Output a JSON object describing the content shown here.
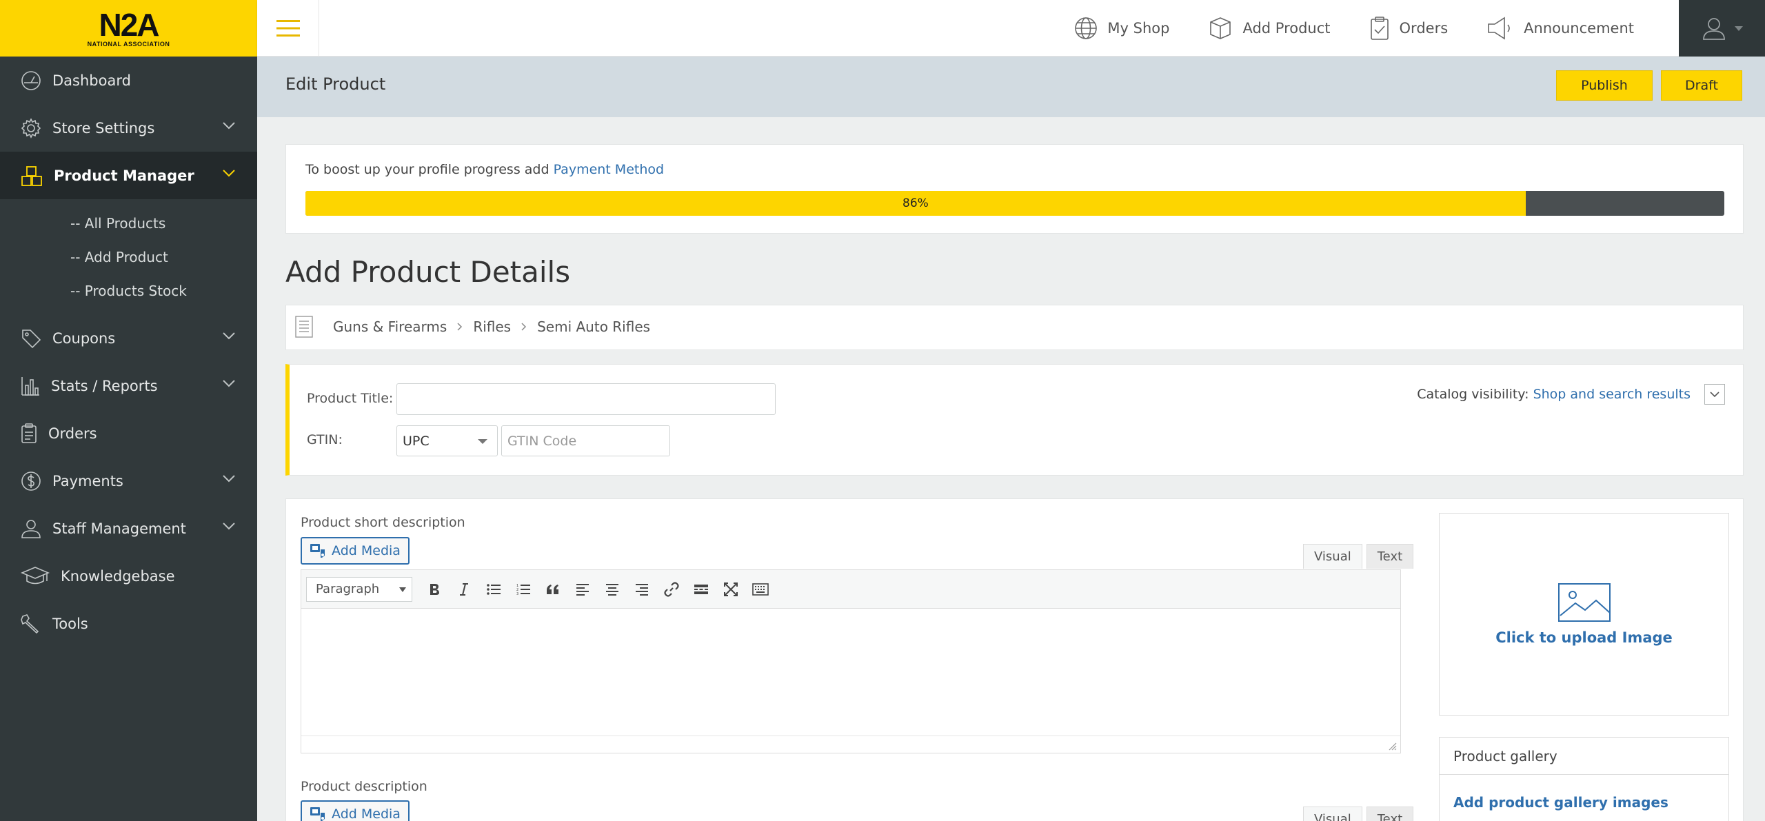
{
  "logo": {
    "main": "N2A",
    "sub": "NATIONAL ASSOCIATION"
  },
  "topnav": [
    {
      "icon": "globe-icon",
      "label": "My Shop"
    },
    {
      "icon": "box-icon",
      "label": "Add Product"
    },
    {
      "icon": "clipboard-icon",
      "label": "Orders"
    },
    {
      "icon": "megaphone-icon",
      "label": "Announcement"
    }
  ],
  "sidebar": {
    "items": [
      {
        "icon": "dashboard-icon",
        "label": "Dashboard"
      },
      {
        "icon": "gear-icon",
        "label": "Store Settings"
      },
      {
        "icon": "boxes-icon",
        "label": "Product Manager"
      },
      {
        "icon": "tag-icon",
        "label": "Coupons"
      },
      {
        "icon": "bar-chart-icon",
        "label": "Stats / Reports"
      },
      {
        "icon": "clipboard-icon",
        "label": "Orders"
      },
      {
        "icon": "dollar-icon",
        "label": "Payments"
      },
      {
        "icon": "user-icon",
        "label": "Staff Management"
      },
      {
        "icon": "graduation-cap-icon",
        "label": "Knowledgebase"
      },
      {
        "icon": "wrench-icon",
        "label": "Tools"
      }
    ],
    "subitems": [
      "-- All Products",
      "-- Add Product",
      "-- Products Stock"
    ]
  },
  "page": {
    "title": "Edit Product",
    "publish": "Publish",
    "draft": "Draft"
  },
  "progress": {
    "text": "To boost up your profile progress add",
    "link": "Payment Method",
    "value": 86,
    "label": "86%"
  },
  "section_title": "Add Product Details",
  "breadcrumb": [
    "Guns & Firearms",
    "Rifles",
    "Semi Auto Rifles"
  ],
  "form": {
    "title_label": "Product Title:",
    "title_value": "",
    "gtin_label": "GTIN:",
    "gtin_type": "UPC",
    "gtin_placeholder": "GTIN Code",
    "catalog_label": "Catalog visibility:",
    "catalog_value": "Shop and search results"
  },
  "editor": {
    "short_label": "Product short description",
    "desc_label": "Product description",
    "add_media": "Add Media",
    "tab_visual": "Visual",
    "tab_text": "Text",
    "format": "Paragraph"
  },
  "upload": {
    "label": "Click to upload Image"
  },
  "gallery": {
    "title": "Product gallery",
    "link": "Add product gallery images"
  },
  "colors": {
    "accent": "#fdd500",
    "sidebar": "#31393b",
    "link": "#2f6fad"
  }
}
